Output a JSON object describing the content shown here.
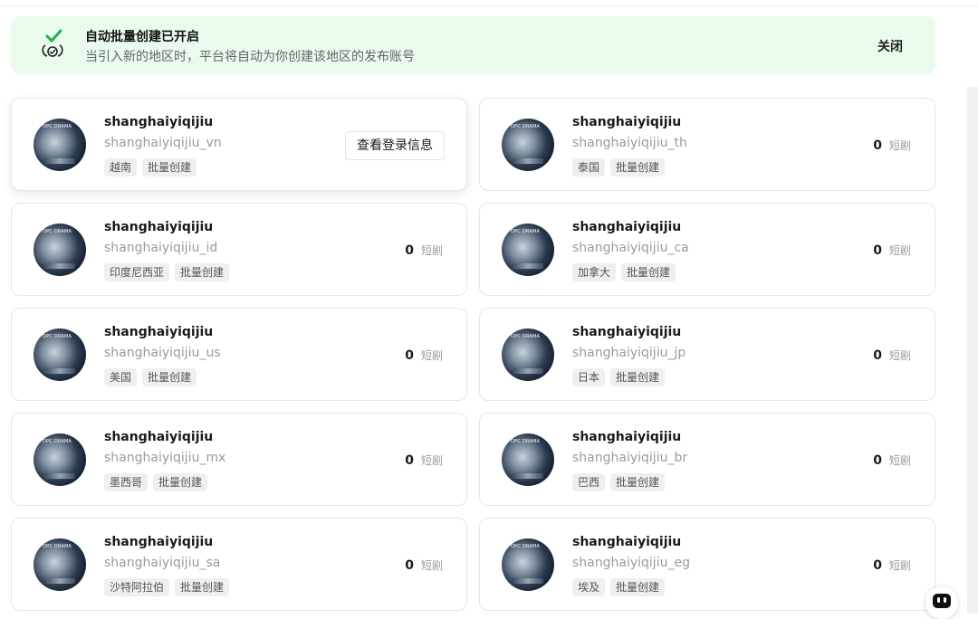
{
  "banner": {
    "title": "自动批量创建已开启",
    "description": "当引入新的地区时，平台将自动为你创建该地区的发布账号",
    "close_label": "关闭",
    "accent_color": "#eafaed"
  },
  "common": {
    "count_unit": "短剧",
    "login_button_label": "查看登录信息",
    "batch_tag": "批量创建"
  },
  "accounts": [
    {
      "name": "shanghaiyiqijiu",
      "handle": "shanghaiyiqijiu_vn",
      "region": "越南",
      "count": null,
      "show_login": true
    },
    {
      "name": "shanghaiyiqijiu",
      "handle": "shanghaiyiqijiu_th",
      "region": "泰国",
      "count": "0"
    },
    {
      "name": "shanghaiyiqijiu",
      "handle": "shanghaiyiqijiu_id",
      "region": "印度尼西亚",
      "count": "0"
    },
    {
      "name": "shanghaiyiqijiu",
      "handle": "shanghaiyiqijiu_ca",
      "region": "加拿大",
      "count": "0"
    },
    {
      "name": "shanghaiyiqijiu",
      "handle": "shanghaiyiqijiu_us",
      "region": "美国",
      "count": "0"
    },
    {
      "name": "shanghaiyiqijiu",
      "handle": "shanghaiyiqijiu_jp",
      "region": "日本",
      "count": "0"
    },
    {
      "name": "shanghaiyiqijiu",
      "handle": "shanghaiyiqijiu_mx",
      "region": "墨西哥",
      "count": "0"
    },
    {
      "name": "shanghaiyiqijiu",
      "handle": "shanghaiyiqijiu_br",
      "region": "巴西",
      "count": "0"
    },
    {
      "name": "shanghaiyiqijiu",
      "handle": "shanghaiyiqijiu_sa",
      "region": "沙特阿拉伯",
      "count": "0"
    },
    {
      "name": "shanghaiyiqijiu",
      "handle": "shanghaiyiqijiu_eg",
      "region": "埃及",
      "count": "0"
    }
  ],
  "avatar_caption": "OPC DRAMA",
  "icons": {
    "banner": "check-handshake-icon",
    "assistant": "assistant-bot-icon"
  }
}
